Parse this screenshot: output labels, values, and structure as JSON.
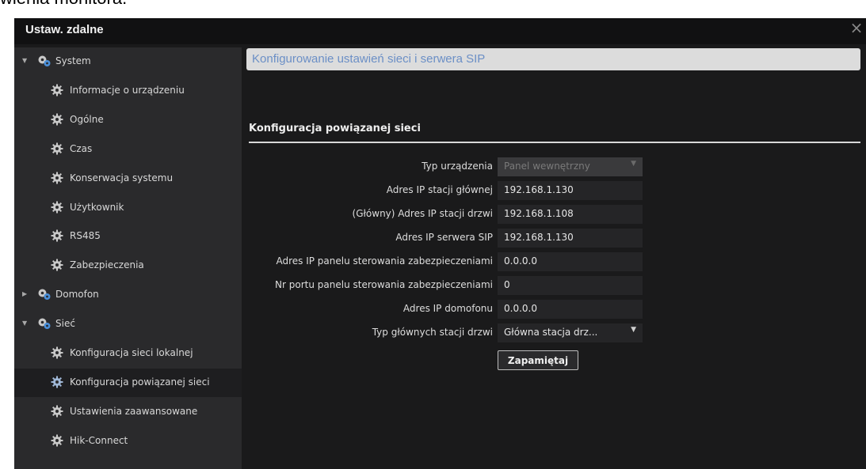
{
  "caption": "wienia monitora.",
  "window": {
    "title": "Ustaw. zdalne",
    "close_glyph": "×"
  },
  "sidebar": {
    "items": [
      {
        "label": "System",
        "level": 0,
        "expanded": true,
        "icon": "gear-group-icon"
      },
      {
        "label": "Informacje o urządzeniu",
        "level": 1,
        "icon": "gear-icon"
      },
      {
        "label": "Ogólne",
        "level": 1,
        "icon": "gear-icon"
      },
      {
        "label": "Czas",
        "level": 1,
        "icon": "gear-icon"
      },
      {
        "label": "Konserwacja systemu",
        "level": 1,
        "icon": "gear-icon"
      },
      {
        "label": "Użytkownik",
        "level": 1,
        "icon": "gear-icon"
      },
      {
        "label": "RS485",
        "level": 1,
        "icon": "gear-icon"
      },
      {
        "label": "Zabezpieczenia",
        "level": 1,
        "icon": "gear-icon"
      },
      {
        "label": "Domofon",
        "level": 0,
        "expanded": false,
        "icon": "gear-group-icon"
      },
      {
        "label": "Sieć",
        "level": 0,
        "expanded": true,
        "icon": "gear-group-icon"
      },
      {
        "label": "Konfiguracja sieci lokalnej",
        "level": 1,
        "icon": "gear-icon"
      },
      {
        "label": "Konfiguracja powiązanej sieci",
        "level": 1,
        "icon": "gear-icon",
        "selected": true
      },
      {
        "label": "Ustawienia zaawansowane",
        "level": 1,
        "icon": "gear-icon"
      },
      {
        "label": "Hik-Connect",
        "level": 1,
        "icon": "gear-icon"
      }
    ]
  },
  "main": {
    "header": "Konfigurowanie ustawień sieci i serwera SIP",
    "section_title": "Konfiguracja powiązanej sieci",
    "fields": [
      {
        "label": "Typ urządzenia",
        "value": "Panel wewnętrzny",
        "type": "select",
        "disabled": true
      },
      {
        "label": "Adres IP stacji głównej",
        "value": "192.168.1.130",
        "type": "text"
      },
      {
        "label": "(Główny) Adres IP stacji drzwi",
        "value": "192.168.1.108",
        "type": "text"
      },
      {
        "label": "Adres IP serwera SIP",
        "value": "192.168.1.130",
        "type": "text"
      },
      {
        "label": "Adres IP panelu sterowania zabezpieczeniami",
        "value": "0.0.0.0",
        "type": "text"
      },
      {
        "label": "Nr portu panelu sterowania zabezpieczeniami",
        "value": "0",
        "type": "text"
      },
      {
        "label": "Adres IP domofonu",
        "value": "0.0.0.0",
        "type": "text"
      },
      {
        "label": "Typ głównych stacji drzwi",
        "value": "Główna stacja drz...",
        "type": "select"
      }
    ],
    "save_label": "Zapamiętaj"
  },
  "colors": {
    "window_bg": "#1a1a1b",
    "sidebar_bg": "#2a2a2c",
    "header_text": "#6b8fc6",
    "icon_gray": "#c8c8c8",
    "icon_blue": "#4a8fd9"
  }
}
